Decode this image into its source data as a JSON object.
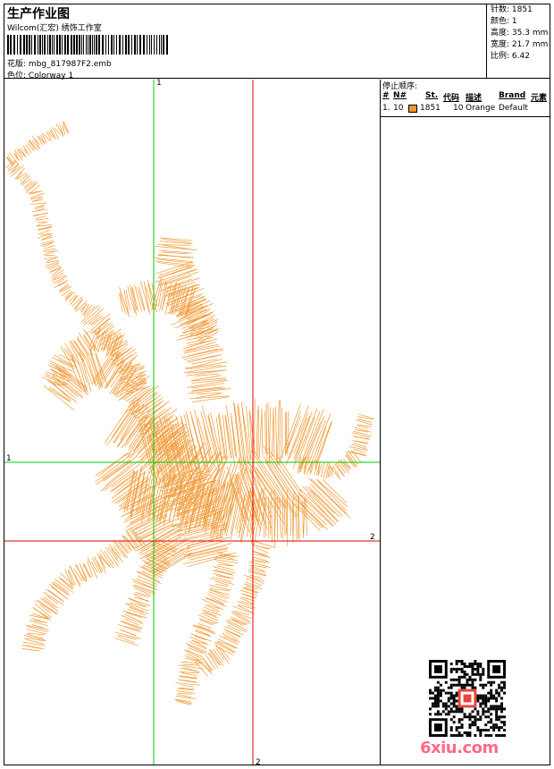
{
  "header": {
    "title": "生产作业图",
    "studio": "Wilcom(汇宏) 绣饰工作室",
    "design_label": "花版:",
    "design_name": "mbg_817987F2.emb",
    "colorway_label": "色位:",
    "colorway_name": "Colorway 1"
  },
  "stats": [
    {
      "label": "针数:",
      "value": "1851"
    },
    {
      "label": "颜色:",
      "value": "1"
    },
    {
      "label": "高度:",
      "value": "35.3 mm"
    },
    {
      "label": "宽度:",
      "value": "21.7 mm"
    },
    {
      "label": "比例:",
      "value": "6.42"
    }
  ],
  "stop_sequence": {
    "title": "停止顺序:",
    "columns": [
      "#",
      "N#",
      "St.",
      "代码",
      "描述",
      "Brand",
      "元素"
    ],
    "rows": [
      {
        "index": "1.",
        "needle": "10",
        "color": "#f0962d",
        "stitches": "1851",
        "code": "10",
        "description": "Orange",
        "brand": "Default",
        "element": ""
      }
    ]
  },
  "guides": {
    "v1": "1",
    "h1": "1",
    "v2": "2",
    "h2": "2"
  },
  "watermark": "6xiu.com",
  "colors": {
    "thread": "#f0962d",
    "guide_green": "#00cc00",
    "guide_red": "#e00000"
  }
}
